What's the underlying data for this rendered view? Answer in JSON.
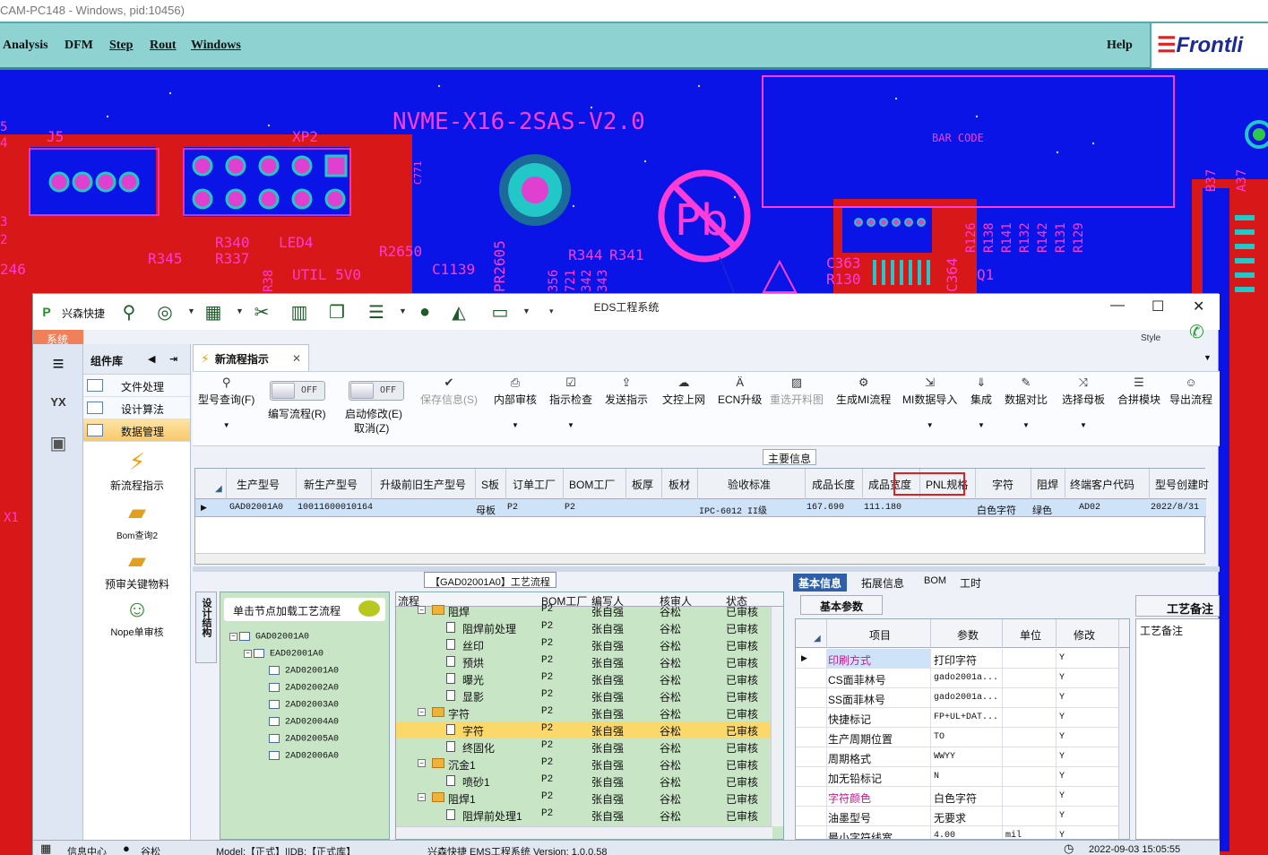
{
  "cam": {
    "title": "CAM-PC148 - Windows, pid:10456)",
    "menus": [
      "Analysis",
      "DFM",
      "Step",
      "Rout",
      "Windows"
    ],
    "help": "Help",
    "logo": "Frontli",
    "board": {
      "board_name": "NVME-X16-2SAS-V2.0",
      "bar_code": "BAR CODE",
      "refdes": [
        "J5",
        "XP2",
        "C771",
        "R340",
        "LED4",
        "R2650",
        "R345",
        "R337",
        "R38",
        "UTIL 5V0",
        "C1139",
        "PR2605",
        "R344",
        "R341",
        "356",
        "721",
        "342",
        "343",
        "C363",
        "R130",
        "C364",
        "Q1",
        "R126",
        "R138",
        "R141",
        "R132",
        "R142",
        "R131",
        "R129",
        "B37",
        "A37",
        "246",
        "X1",
        "5",
        "4",
        "3",
        "2"
      ],
      "pb_symbol": "Pb",
      "colors": {
        "bg": "#0a14e6",
        "copper": "#d81818",
        "pad": "#e040d0",
        "silk": "#ff3cd8",
        "teal": "#22c7c7"
      }
    }
  },
  "eds": {
    "app_name": "兴森快捷",
    "window_title": "EDS工程系统",
    "system_tab": "系统",
    "style_label": "Style",
    "left_sidebar": {
      "badge": "YX"
    },
    "component_library": {
      "title": "组件库",
      "items": [
        {
          "label": "文件处理",
          "active": false
        },
        {
          "label": "设计算法",
          "active": false
        },
        {
          "label": "数据管理",
          "active": true
        }
      ],
      "big_items": [
        "新流程指示",
        "Bom查询2",
        "预审关键物料",
        "Nope单审核"
      ]
    },
    "doc_tab": "新流程指示",
    "toolbar": [
      {
        "label": "型号查询(F)",
        "icon": "search-icon",
        "enabled": true
      },
      {
        "label": "编写流程(R)",
        "toggle": "OFF"
      },
      {
        "label": "启动修改(E)",
        "sublabel": "取消(Z)",
        "toggle": "OFF"
      },
      {
        "label": "保存信息(S)",
        "icon": "check-icon",
        "enabled": false
      },
      {
        "label": "内部审核",
        "icon": "printer-icon",
        "enabled": true
      },
      {
        "label": "指示检查",
        "icon": "checkbox-icon",
        "enabled": true
      },
      {
        "label": "发送指示",
        "icon": "upload-icon",
        "enabled": true
      },
      {
        "label": "文控上网",
        "icon": "cloud-icon",
        "enabled": true
      },
      {
        "label": "ECN升级",
        "icon": "ecn-icon",
        "enabled": true
      },
      {
        "label": "重选开料图",
        "icon": "image-icon",
        "enabled": false
      },
      {
        "label": "生成MI流程",
        "icon": "gears-icon",
        "enabled": true
      },
      {
        "label": "MI数据导入",
        "icon": "import-icon",
        "enabled": true
      },
      {
        "label": "集成",
        "icon": "download-icon",
        "enabled": true
      },
      {
        "label": "数据对比",
        "icon": "compare-icon",
        "enabled": true
      },
      {
        "label": "选择母板",
        "icon": "shuffle-icon",
        "enabled": true
      },
      {
        "label": "合拼模块",
        "icon": "list-icon",
        "enabled": true
      },
      {
        "label": "导出流程",
        "icon": "smile-icon",
        "enabled": true
      }
    ],
    "main_info": {
      "title": "主要信息",
      "columns": [
        "生产型号",
        "新生产型号",
        "升级前旧生产型号",
        "S板",
        "订单工厂",
        "BOM工厂",
        "板厚",
        "板材",
        "验收标准",
        "成品长度",
        "成品宽度",
        "PNL规格",
        "字符",
        "阻焊",
        "终端客户代码",
        "型号创建时"
      ],
      "rows": [
        [
          "GAD02001A0",
          "10011600010164",
          "",
          "母板",
          "P2",
          "P2",
          "",
          "",
          "IPC-6012 II级",
          "167.690",
          "111.180",
          "",
          "白色字符",
          "绿色",
          "AD02",
          "2022/8/31"
        ]
      ]
    },
    "process_flow": {
      "title": "【GAD02001A0】工艺流程",
      "side_tab": "设计结构",
      "hint": "单击节点加载工艺流程",
      "tree": [
        {
          "label": "GAD02001A0",
          "level": 0
        },
        {
          "label": "EAD02001A0",
          "level": 1
        },
        {
          "label": "2AD02001A0",
          "level": 2
        },
        {
          "label": "2AD02002A0",
          "level": 2
        },
        {
          "label": "2AD02003A0",
          "level": 2
        },
        {
          "label": "2AD02004A0",
          "level": 2
        },
        {
          "label": "2AD02005A0",
          "level": 2
        },
        {
          "label": "2AD02006A0",
          "level": 2
        }
      ],
      "columns": [
        "流程",
        "BOM工厂",
        "编写人",
        "核审人",
        "状态"
      ],
      "rows": [
        {
          "name": "阻焊",
          "type": "folder",
          "bom": "P2",
          "writer": "张自强",
          "reviewer": "谷松",
          "status": "已审核"
        },
        {
          "name": "阻焊前处理",
          "type": "doc",
          "bom": "P2",
          "writer": "张自强",
          "reviewer": "谷松",
          "status": "已审核"
        },
        {
          "name": "丝印",
          "type": "doc",
          "bom": "P2",
          "writer": "张自强",
          "reviewer": "谷松",
          "status": "已审核"
        },
        {
          "name": "预烘",
          "type": "doc",
          "bom": "P2",
          "writer": "张自强",
          "reviewer": "谷松",
          "status": "已审核"
        },
        {
          "name": "曝光",
          "type": "doc",
          "bom": "P2",
          "writer": "张自强",
          "reviewer": "谷松",
          "status": "已审核"
        },
        {
          "name": "显影",
          "type": "doc",
          "bom": "P2",
          "writer": "张自强",
          "reviewer": "谷松",
          "status": "已审核"
        },
        {
          "name": "字符",
          "type": "folder",
          "bom": "P2",
          "writer": "张自强",
          "reviewer": "谷松",
          "status": "已审核"
        },
        {
          "name": "字符",
          "type": "doc",
          "bom": "P2",
          "writer": "张自强",
          "reviewer": "谷松",
          "status": "已审核",
          "selected": true
        },
        {
          "name": "终固化",
          "type": "doc",
          "bom": "P2",
          "writer": "张自强",
          "reviewer": "谷松",
          "status": "已审核"
        },
        {
          "name": "沉金1",
          "type": "folder",
          "bom": "P2",
          "writer": "张自强",
          "reviewer": "谷松",
          "status": "已审核"
        },
        {
          "name": "喷砂1",
          "type": "doc",
          "bom": "P2",
          "writer": "张自强",
          "reviewer": "谷松",
          "status": "已审核"
        },
        {
          "name": "阻焊1",
          "type": "folder",
          "bom": "P2",
          "writer": "张自强",
          "reviewer": "谷松",
          "status": "已审核"
        },
        {
          "name": "阻焊前处理1",
          "type": "doc",
          "bom": "P2",
          "writer": "张自强",
          "reviewer": "谷松",
          "status": "已审核"
        }
      ]
    },
    "details": {
      "tabs": [
        "基本信息",
        "拓展信息",
        "BOM",
        "工时"
      ],
      "active_tab": "基本信息",
      "subtab": "基本参数",
      "columns": [
        "项目",
        "参数",
        "单位",
        "修改"
      ],
      "rows": [
        {
          "item": "印刷方式",
          "value": "打印字符",
          "unit": "",
          "edit": "Y",
          "highlight": true,
          "color": "#c0208a"
        },
        {
          "item": "CS面菲林号",
          "value": "gado2001a...",
          "unit": "",
          "edit": "Y"
        },
        {
          "item": "SS面菲林号",
          "value": "gado2001a...",
          "unit": "",
          "edit": "Y"
        },
        {
          "item": "快捷标记",
          "value": "FP+UL+DAT...",
          "unit": "",
          "edit": "Y"
        },
        {
          "item": "生产周期位置",
          "value": "TO",
          "unit": "",
          "edit": "Y"
        },
        {
          "item": "周期格式",
          "value": "WWYY",
          "unit": "",
          "edit": "Y"
        },
        {
          "item": "加无铅标记",
          "value": "N",
          "unit": "",
          "edit": "Y"
        },
        {
          "item": "字符颜色",
          "value": "白色字符",
          "unit": "",
          "edit": "Y",
          "color": "#c0208a"
        },
        {
          "item": "油墨型号",
          "value": "无要求",
          "unit": "",
          "edit": "Y"
        },
        {
          "item": "最小字符线宽",
          "value": "4.00",
          "unit": "mil",
          "edit": "Y"
        }
      ],
      "remarks_title": "工艺备注",
      "remarks_label": "工艺备注"
    },
    "status": {
      "info_center": "信息中心",
      "user": "谷松",
      "model": "Model:【正式】||DB:【正式库】",
      "version": "兴森快捷 EMS工程系统 Version: 1.0.0.58",
      "datetime": "2022-09-03 15:05:55"
    }
  }
}
